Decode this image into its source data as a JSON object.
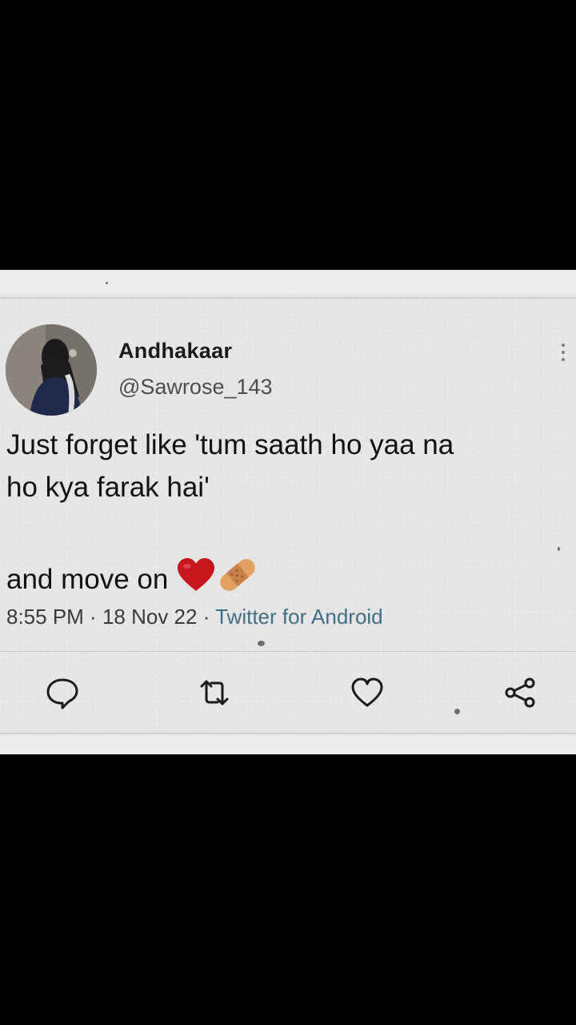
{
  "tweet": {
    "display_name": "Andhakaar",
    "handle": "@Sawrose_143",
    "text_line1": "Just forget like 'tum saath ho yaa na",
    "text_line2": "ho kya farak hai'",
    "text_line3": "and move on",
    "emojis": [
      "red-heart-icon",
      "adhesive-bandage-icon"
    ],
    "time": "8:55 PM",
    "separator": " · ",
    "date": "18 Nov 22",
    "source": "Twitter for Android"
  },
  "actions": [
    "reply-icon",
    "retweet-icon",
    "like-icon",
    "share-icon"
  ],
  "colors": {
    "card_background": "#e6e6e6",
    "frame": "#000000",
    "source_link": "#3f6f86",
    "heart": "#c8161d"
  }
}
